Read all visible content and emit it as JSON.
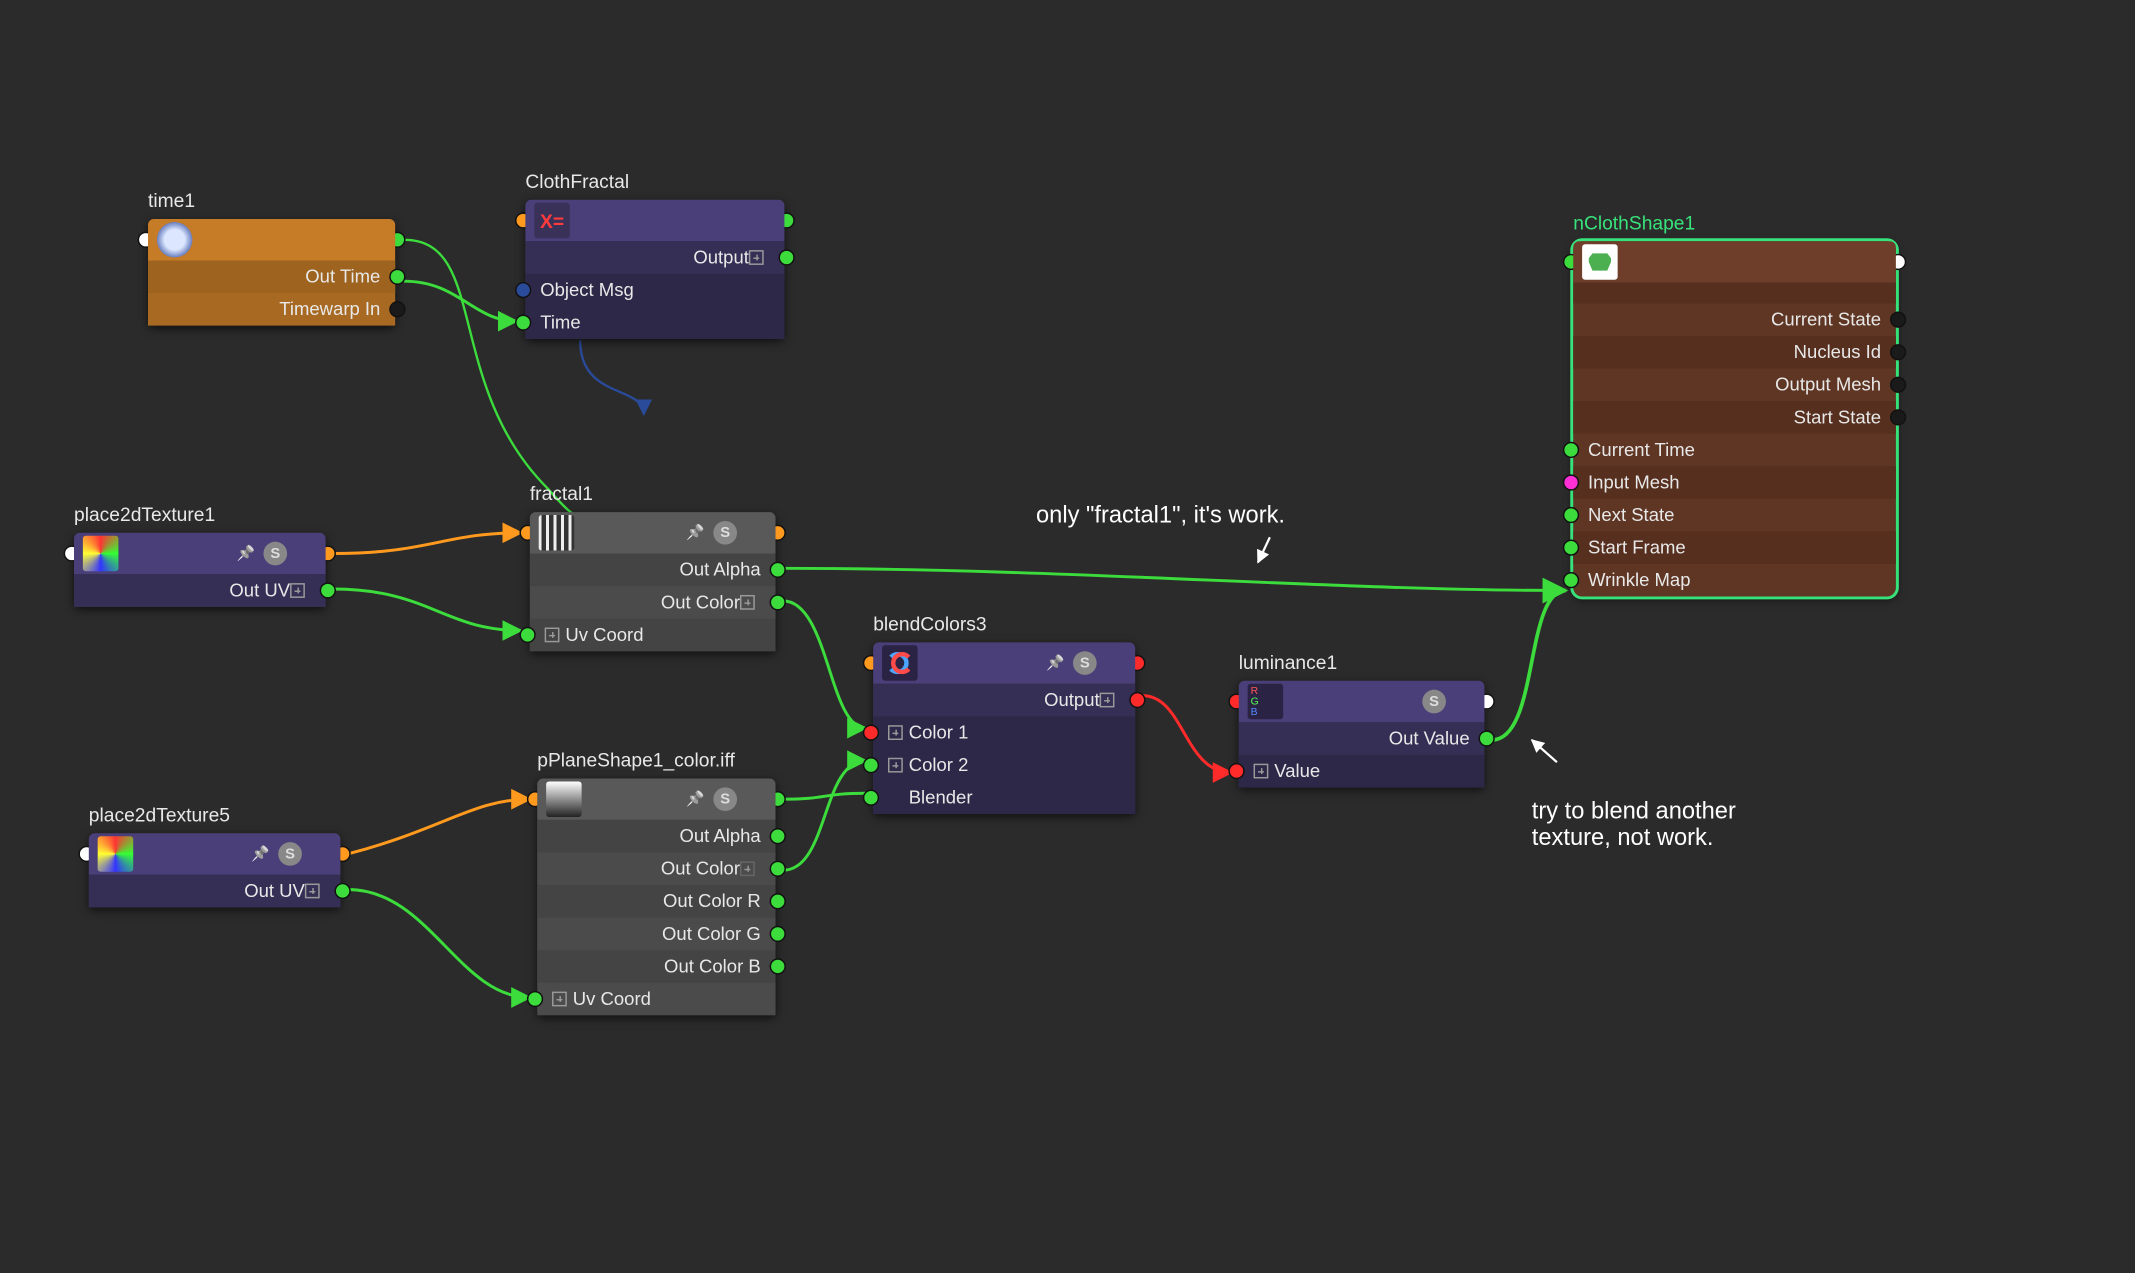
{
  "annotations": {
    "a1": "only \"fractal1\", it's work.",
    "a2": "try to blend another\ntexture, not work."
  },
  "nodes": {
    "time1": {
      "title": "time1",
      "outputs": [
        "Out Time",
        "Timewarp In"
      ]
    },
    "clothFractal": {
      "title": "ClothFractal",
      "thumb_label": "X=",
      "outputs": [
        "Output"
      ],
      "inputs": [
        "Object Msg",
        "Time"
      ]
    },
    "place2dTexture1": {
      "title": "place2dTexture1",
      "outputs": [
        "Out UV"
      ]
    },
    "fractal1": {
      "title": "fractal1",
      "outputs": [
        "Out Alpha",
        "Out Color"
      ],
      "inputs": [
        "Uv Coord"
      ]
    },
    "place2dTexture5": {
      "title": "place2dTexture5",
      "outputs": [
        "Out UV"
      ]
    },
    "pPlaneShape1": {
      "title": "pPlaneShape1_color.iff",
      "outputs": [
        "Out Alpha",
        "Out Color",
        "Out Color R",
        "Out Color G",
        "Out Color B"
      ],
      "inputs": [
        "Uv Coord"
      ]
    },
    "blendColors3": {
      "title": "blendColors3",
      "outputs": [
        "Output"
      ],
      "inputs": [
        "Color 1",
        "Color 2",
        "Blender"
      ]
    },
    "luminance1": {
      "title": "luminance1",
      "outputs": [
        "Out Value"
      ],
      "inputs": [
        "Value"
      ]
    },
    "nClothShape1": {
      "title": "nClothShape1",
      "right_ports": [
        "Current State",
        "Nucleus Id",
        "Output Mesh",
        "Start State"
      ],
      "left_ports": [
        "Current Time",
        "Input Mesh",
        "Next State",
        "Start Frame",
        "Wrinkle Map"
      ]
    }
  },
  "colors": {
    "wire_green": "#3cdc3c",
    "wire_orange": "#ff9a1f",
    "wire_blue": "#2a4a9a",
    "wire_red": "#ff2b2b"
  }
}
